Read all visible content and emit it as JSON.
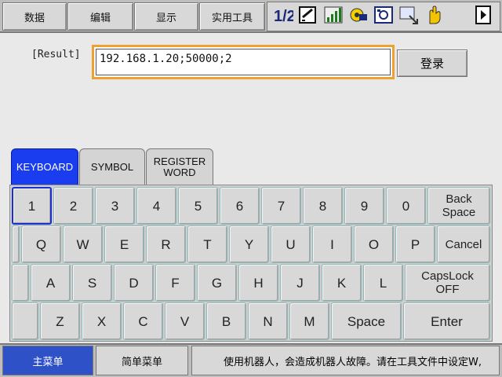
{
  "top_menu": [
    "数据",
    "编辑",
    "显示",
    "实用工具"
  ],
  "toolbar_icons": [
    "tool-number-icon",
    "edit-check-icon",
    "signal-icon",
    "gear-chip-icon",
    "camera-frame-icon",
    "monitor-arrow-icon",
    "hand-icon",
    "exit-arrow-icon"
  ],
  "toolbar_icon_text": "1/2",
  "result": {
    "label": "[Result]",
    "value": "192.168.1.20;50000;2"
  },
  "login_label": "登录",
  "keyboard_tabs": {
    "keyboard": "KEYBOARD",
    "symbol": "SYMBOL",
    "register_line1": "REGISTER",
    "register_line2": "WORD"
  },
  "keys": {
    "row1": [
      "1",
      "2",
      "3",
      "4",
      "5",
      "6",
      "7",
      "8",
      "9",
      "0"
    ],
    "backspace_line1": "Back",
    "backspace_line2": "Space",
    "row2": [
      "Q",
      "W",
      "E",
      "R",
      "T",
      "Y",
      "U",
      "I",
      "O",
      "P"
    ],
    "cancel": "Cancel",
    "row3": [
      "A",
      "S",
      "D",
      "F",
      "G",
      "H",
      "J",
      "K",
      "L"
    ],
    "capslock_line1": "CapsLock",
    "capslock_line2": "OFF",
    "row4": [
      "Z",
      "X",
      "C",
      "V",
      "B",
      "N",
      "M"
    ],
    "space": "Space",
    "enter": "Enter"
  },
  "bottom": {
    "main_menu": "主菜单",
    "simple_menu": "简单菜单",
    "message": "使用机器人，会造成机器人故障。请在工具文件中设定W,"
  },
  "colors": {
    "accent_active_tab": "#1a3df0",
    "field_border": "#f0a030",
    "main_menu_active": "#2f51c8"
  }
}
